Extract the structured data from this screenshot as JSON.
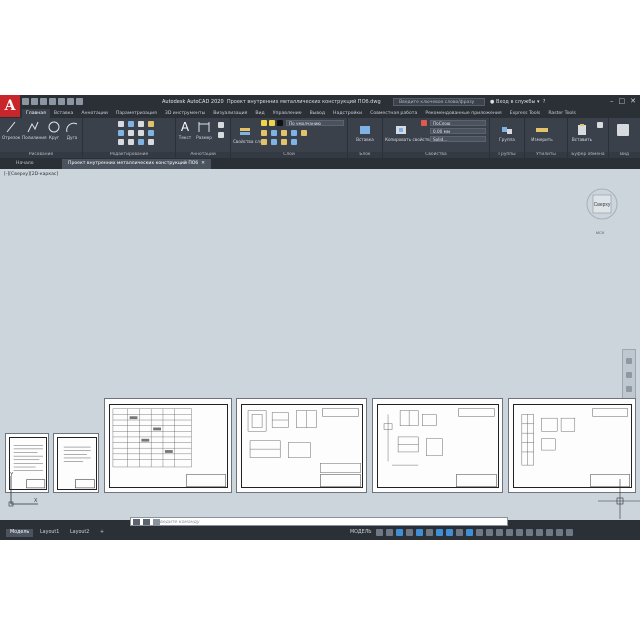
{
  "app": {
    "logo_letter": "A",
    "title_app": "Autodesk AutoCAD 2020",
    "title_file": "Проект внутренних металлических конструкций ПОб.dwg",
    "search_placeholder": "Введите ключевое слово/фразу",
    "signin": "Вход в службы",
    "accent": "#c8262b"
  },
  "ribbon_tabs": [
    "Главная",
    "Вставка",
    "Аннотации",
    "Параметризация",
    "3D инструменты",
    "Визуализация",
    "Вид",
    "Управление",
    "Вывод",
    "Надстройки",
    "Совместная работа",
    "Рекомендованные приложения",
    "Express Tools",
    "Raster Tools"
  ],
  "ribbon": {
    "draw": {
      "title": "Рисование",
      "line": "Отрезок",
      "polyline": "Полилиния",
      "circle": "Круг",
      "arc": "Дуга"
    },
    "modify": {
      "title": "Редактирование"
    },
    "annotation": {
      "title": "Аннотации",
      "text": "Текст",
      "dimension": "Размер"
    },
    "layers": {
      "title": "Слои",
      "layer_props": "Свойства слоя",
      "layer_current": "По умолчанию"
    },
    "block": {
      "title": "Блок",
      "insert": "Вставка"
    },
    "properties": {
      "title": "Свойства",
      "match": "Копировать свойства",
      "color": "ПоСлою",
      "lineweight": "0,00 мм",
      "linetype": "Solid..."
    },
    "groups": {
      "title": "Группы",
      "group": "Группа"
    },
    "utilities": {
      "title": "Утилиты",
      "measure": "Измерить"
    },
    "clipboard": {
      "title": "Буфер обмена",
      "paste": "Вставить"
    },
    "view": {
      "title": "Вид"
    }
  },
  "doc_tabs": [
    {
      "label": "Начало"
    },
    {
      "label": "Проект внутренних металлических конструкций ПОб"
    }
  ],
  "viewport_label": "[-][Сверху][2D-каркас]",
  "viewcube": {
    "face": "Сверху",
    "wcs": "МСК"
  },
  "command_placeholder": "Введите команду",
  "status_tabs": [
    "Модель",
    "Layout1",
    "Layout2"
  ],
  "status_model_label": "МОДЕЛЬ",
  "ucs": {
    "x": "X",
    "y": "Y"
  }
}
